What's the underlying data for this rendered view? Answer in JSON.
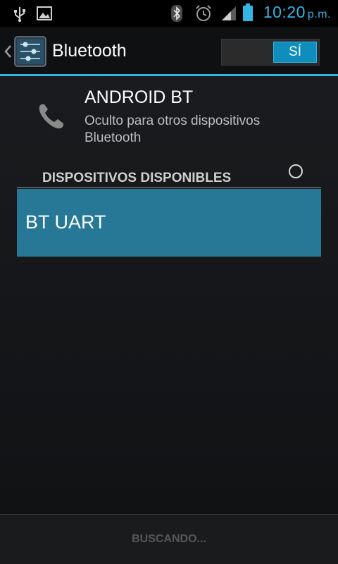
{
  "status_bar": {
    "time": "10:20",
    "ampm": "p.m.",
    "icons": [
      "usb-icon",
      "image-icon",
      "bluetooth-icon",
      "alarm-icon",
      "signal-icon",
      "battery-icon"
    ],
    "accent_color": "#33b5e5"
  },
  "action_bar": {
    "title": "Bluetooth",
    "toggle_label": "SÍ",
    "toggle_state": "on"
  },
  "device": {
    "name": "ANDROID BT",
    "visibility": "Oculto para otros dispositivos Bluetooth",
    "icon": "phone-icon"
  },
  "available_devices": {
    "header": "DISPOSITIVOS DISPONIBLES",
    "items": [
      {
        "label": "BT UART"
      }
    ]
  },
  "footer": {
    "scan_label": "BUSCANDO..."
  }
}
